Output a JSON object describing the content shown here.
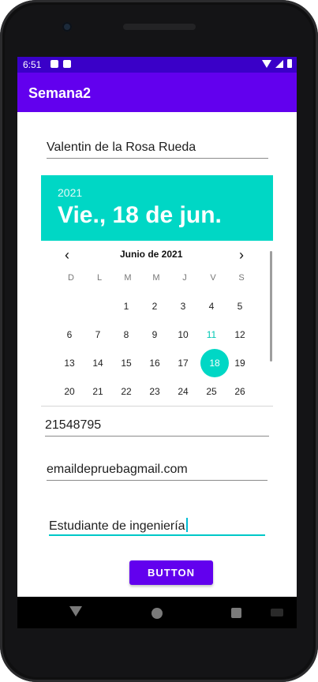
{
  "status_bar": {
    "time": "6:51"
  },
  "app_bar": {
    "title": "Semana2"
  },
  "form": {
    "name_value": "Valentin de la Rosa Rueda",
    "id_value": "21548795",
    "email_value": "emaildepruebagmail.com",
    "occupation_value": "Estudiante de ingeniería",
    "button_label": "BUTTON"
  },
  "calendar": {
    "year": "2021",
    "selected_date": "Vie., 18 de jun.",
    "month_label": "Junio de 2021",
    "weekdays": [
      "D",
      "L",
      "M",
      "M",
      "J",
      "V",
      "S"
    ],
    "week1": [
      "",
      "",
      "1",
      "2",
      "3",
      "4",
      "5"
    ],
    "week2": [
      "6",
      "7",
      "8",
      "9",
      "10",
      "11",
      "12"
    ],
    "week3": [
      "13",
      "14",
      "15",
      "16",
      "17",
      "18",
      "19"
    ],
    "week4": [
      "20",
      "21",
      "22",
      "23",
      "24",
      "25",
      "26"
    ],
    "today_day": "11",
    "selected_day": "18",
    "accent_color": "#00D7C5"
  },
  "theme": {
    "primary": "#6200EE",
    "primary_dark": "#3A00C8"
  },
  "icons": {
    "prev": "chevron-left-icon",
    "next": "chevron-right-icon",
    "back": "back-icon",
    "home": "home-icon",
    "recent": "recent-apps-icon"
  }
}
